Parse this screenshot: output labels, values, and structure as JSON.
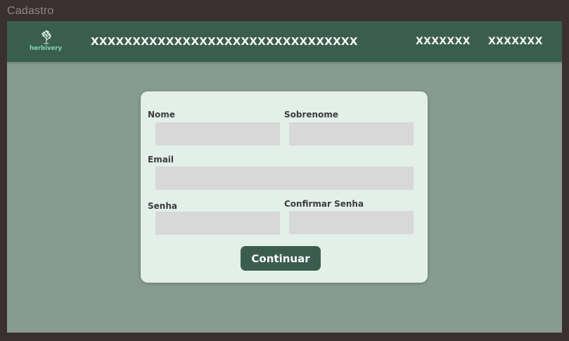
{
  "window": {
    "title": "Cadastro"
  },
  "header": {
    "logo_text": "herbivery",
    "title": "XXXXXXXXXXXXXXXXXXXXXXXXXXXXXXXX",
    "nav": [
      {
        "label": "XXXXXXX"
      },
      {
        "label": "XXXXXXX"
      }
    ]
  },
  "form": {
    "fields": {
      "nome": {
        "label": "Nome",
        "value": ""
      },
      "sobrenome": {
        "label": "Sobrenome",
        "value": ""
      },
      "email": {
        "label": "Email",
        "value": ""
      },
      "senha": {
        "label": "Senha",
        "value": ""
      },
      "confirmar_senha": {
        "label": "Confirmar Senha",
        "value": ""
      }
    },
    "submit_label": "Continuar"
  },
  "colors": {
    "frame_background": "#3a3030",
    "page_background": "#879b93",
    "header_background": "#3a5d4f",
    "card_background": "#e3f0ea",
    "input_background": "#d8d8d8",
    "button_background": "#3a5d4f",
    "logo_accent": "#7fd6b0"
  },
  "icons": {
    "logo": "tree-icon"
  }
}
